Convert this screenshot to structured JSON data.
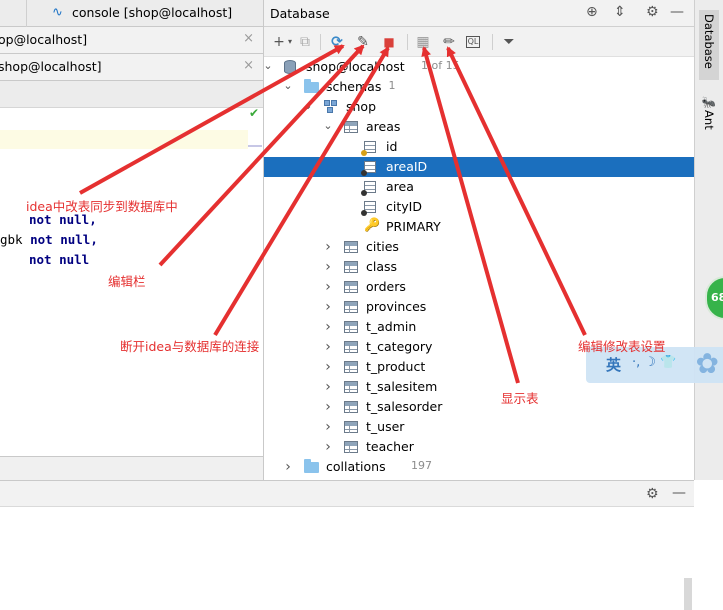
{
  "editor": {
    "tab_console_label": "console [shop@localhost]",
    "tab1_label": "op@localhost]",
    "tab2_label": "shop@localhost]",
    "close_glyph": "×",
    "code_lines": [
      {
        "prefix": "",
        "kw": "not null,"
      },
      {
        "prefix": "gbk ",
        "kw": "not null,"
      },
      {
        "prefix": "",
        "kw": "not null"
      }
    ]
  },
  "database": {
    "title": "Database",
    "toolbar": {
      "add": "+",
      "add_arrow": "▾",
      "copy": "⧉",
      "refresh": "⟳",
      "edit_datasource": "✎",
      "stop": "■",
      "table_view": "▦",
      "edit": "✏",
      "sql": "QL",
      "filter": "⏷"
    },
    "tree": [
      {
        "label": "shop@localhost",
        "count": "1 of 15",
        "depth": 0,
        "expanded": true,
        "icon": "database-icon"
      },
      {
        "label": "schemas",
        "count": "1",
        "depth": 1,
        "expanded": true,
        "icon": "folder-icon"
      },
      {
        "label": "shop",
        "count": "",
        "depth": 2,
        "expanded": true,
        "icon": "schema-icon"
      },
      {
        "label": "areas",
        "count": "",
        "depth": 3,
        "expanded": true,
        "icon": "table-icon"
      },
      {
        "label": "id",
        "count": "",
        "depth": 4,
        "icon": "primary-column-icon"
      },
      {
        "label": "areaID",
        "count": "",
        "depth": 4,
        "icon": "column-icon",
        "selected": true
      },
      {
        "label": "area",
        "count": "",
        "depth": 4,
        "icon": "column-icon"
      },
      {
        "label": "cityID",
        "count": "",
        "depth": 4,
        "icon": "column-icon"
      },
      {
        "label": "PRIMARY",
        "count": "",
        "depth": 4,
        "icon": "key-icon"
      },
      {
        "label": "cities",
        "count": "",
        "depth": 3,
        "expanded": false,
        "icon": "table-icon"
      },
      {
        "label": "class",
        "count": "",
        "depth": 3,
        "expanded": false,
        "icon": "table-icon"
      },
      {
        "label": "orders",
        "count": "",
        "depth": 3,
        "expanded": false,
        "icon": "table-icon"
      },
      {
        "label": "provinces",
        "count": "",
        "depth": 3,
        "expanded": false,
        "icon": "table-icon"
      },
      {
        "label": "t_admin",
        "count": "",
        "depth": 3,
        "expanded": false,
        "icon": "table-icon"
      },
      {
        "label": "t_category",
        "count": "",
        "depth": 3,
        "expanded": false,
        "icon": "table-icon"
      },
      {
        "label": "t_product",
        "count": "",
        "depth": 3,
        "expanded": false,
        "icon": "table-icon"
      },
      {
        "label": "t_salesitem",
        "count": "",
        "depth": 3,
        "expanded": false,
        "icon": "table-icon"
      },
      {
        "label": "t_salesorder",
        "count": "",
        "depth": 3,
        "expanded": false,
        "icon": "table-icon"
      },
      {
        "label": "t_user",
        "count": "",
        "depth": 3,
        "expanded": false,
        "icon": "table-icon"
      },
      {
        "label": "teacher",
        "count": "",
        "depth": 3,
        "expanded": false,
        "icon": "table-icon"
      },
      {
        "label": "collations",
        "count": "197",
        "depth": 1,
        "expanded": false,
        "icon": "folder-icon"
      }
    ]
  },
  "side": {
    "database_tab": "Database",
    "ant_tab": "Ant",
    "badge": "68"
  },
  "ime": {
    "lang": "英",
    "symbols": "·, ☽ 👕"
  },
  "annotations": {
    "sync": "idea中改表同步到数据库中",
    "edit_bar": "编辑栏",
    "disconnect": "断开idea与数据库的连接",
    "edit_table": "编辑修改表设置",
    "show_table": "显示表"
  },
  "colors": {
    "selection": "#1b6fbe",
    "annotation": "#e53030",
    "keyword": "#000080"
  }
}
